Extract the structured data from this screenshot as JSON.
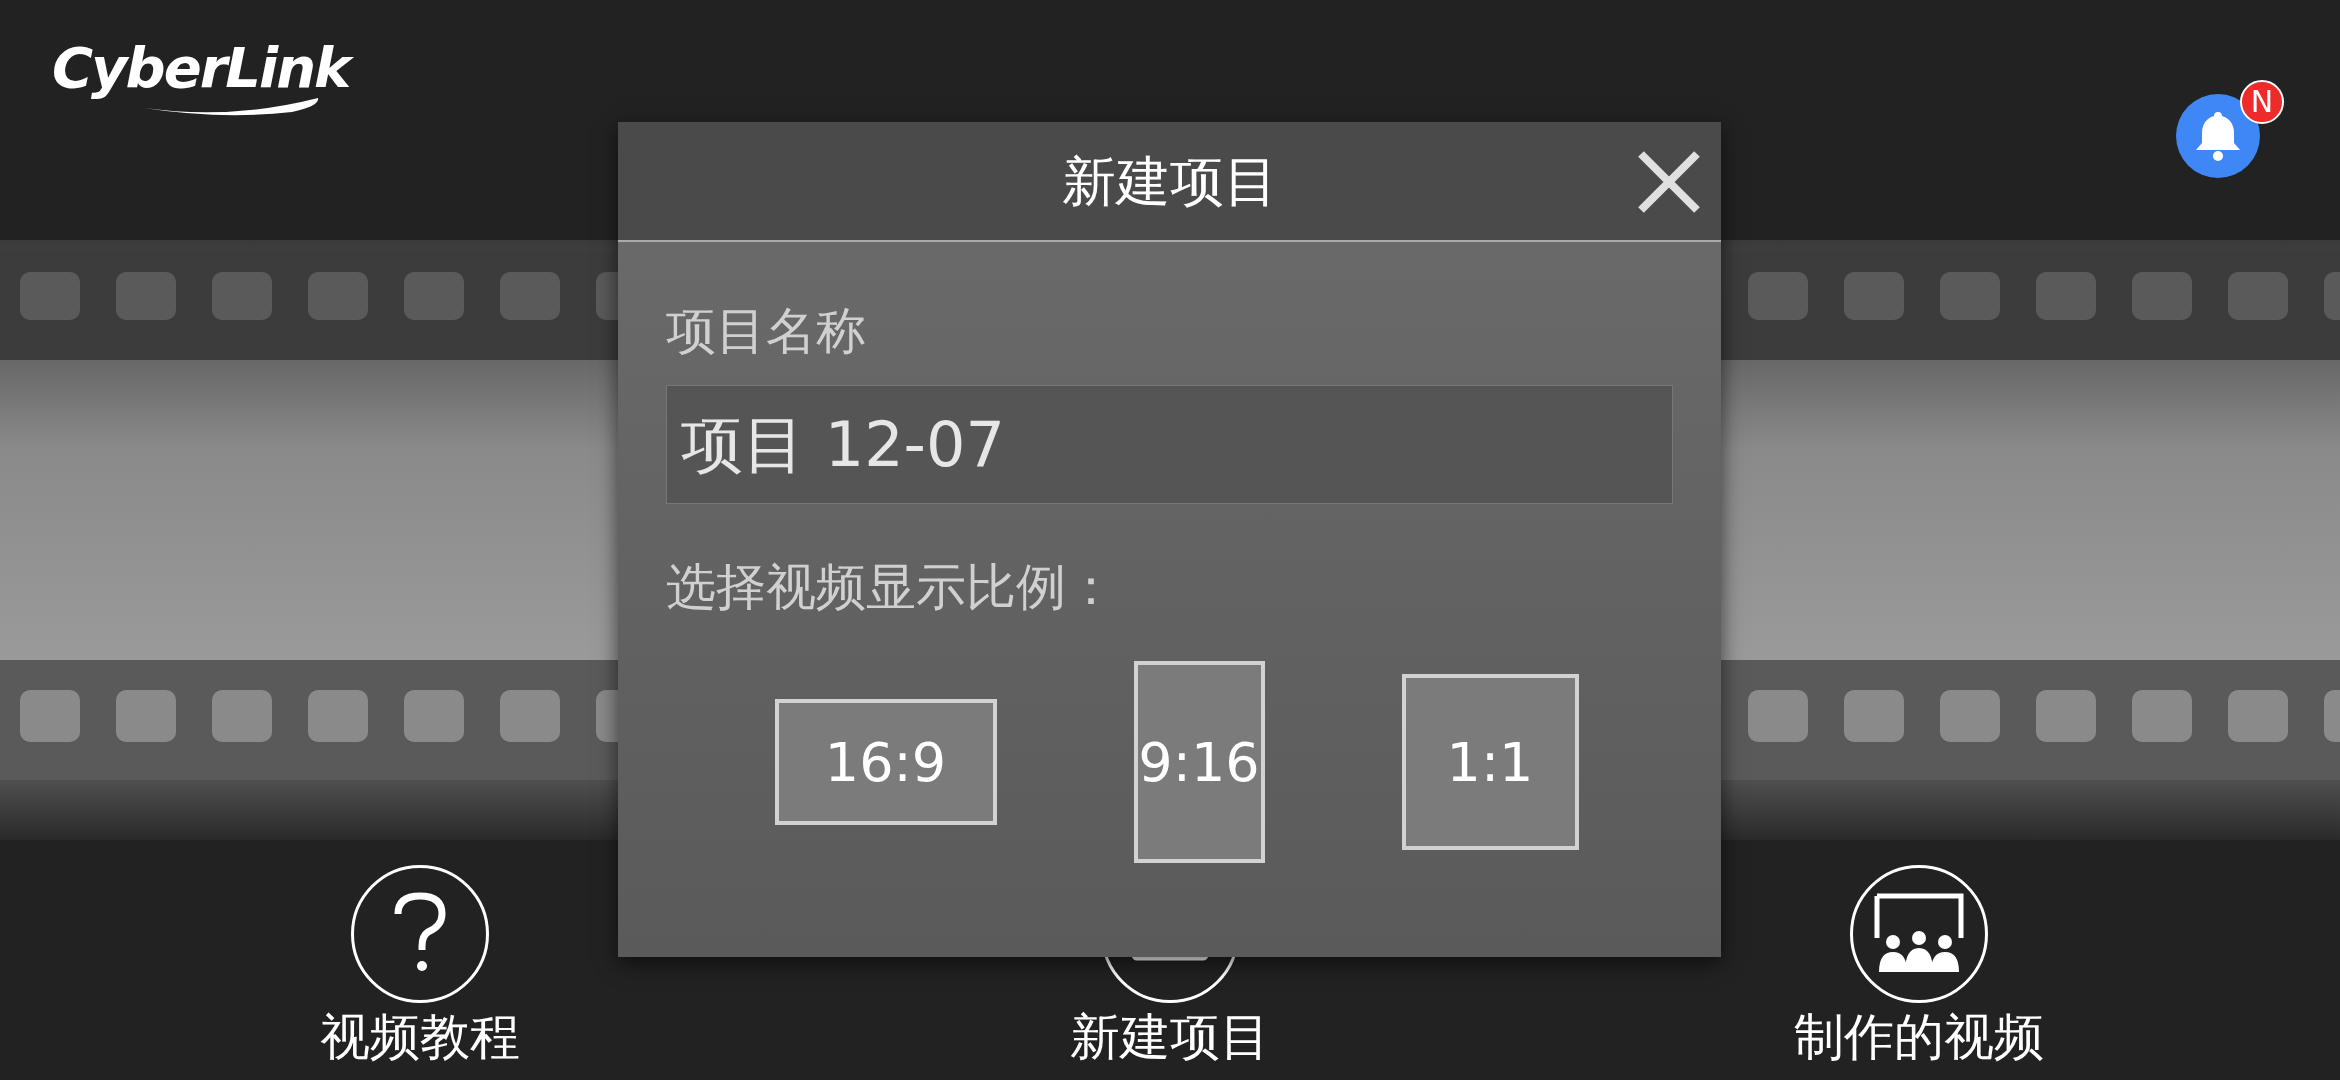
{
  "header": {
    "logo": "CyberLink",
    "notification_badge": "N"
  },
  "nav": [
    {
      "label": "视频教程",
      "kind": "help"
    },
    {
      "label": "新建项目",
      "kind": "new"
    },
    {
      "label": "制作的视频",
      "kind": "gallery"
    }
  ],
  "dialog": {
    "title": "新建项目",
    "name_label": "项目名称",
    "name_value": "项目 12-07",
    "ratio_label": "选择视频显示比例：",
    "ratios": [
      {
        "label": "16:9",
        "kind": "landscape"
      },
      {
        "label": "9:16",
        "kind": "portrait"
      },
      {
        "label": "1:1",
        "kind": "square"
      }
    ]
  }
}
